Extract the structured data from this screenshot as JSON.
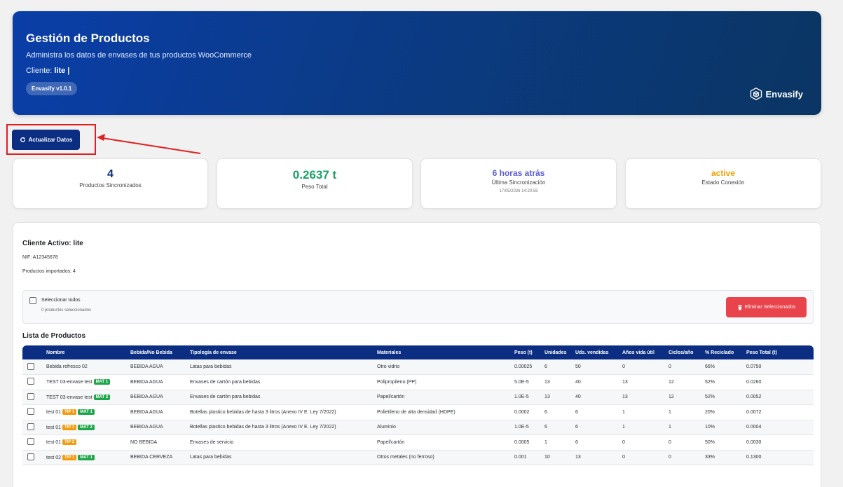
{
  "header": {
    "title": "Gestión de Productos",
    "subtitle": "Administra los datos de envases de tus productos WooCommerce",
    "client_label": "Cliente:",
    "client_value": "lite |",
    "version": "Envasify v1.0.1",
    "brand": "Envasify",
    "brand_icon": "cube-icon"
  },
  "actions": {
    "refresh_label": "Actualizar Datos",
    "refresh_icon": "refresh-icon"
  },
  "stats": [
    {
      "value": "4",
      "label": "Productos Sincronizados",
      "sub": "",
      "color": "#0b2e83"
    },
    {
      "value": "0.2637 t",
      "label": "Peso Total",
      "sub": "",
      "color": "#1aa267"
    },
    {
      "value": "6 horas atrás",
      "label": "Última Sincronización",
      "sub": "17/05/2026 14:20:59",
      "color": "#5b5bd6"
    },
    {
      "value": "active",
      "label": "Estado Conexión",
      "sub": "",
      "color": "#f0a000"
    }
  ],
  "client": {
    "title": "Cliente Activo: lite",
    "nif": "NIF: A12345678",
    "imported": "Productos importados: 4"
  },
  "selection": {
    "select_all": "Seleccionar todos",
    "count": "0 productos seleccionados",
    "delete_label": "Eliminar Seleccionados",
    "delete_icon": "trash-icon"
  },
  "list_title": "Lista de Productos",
  "table": {
    "columns": [
      "Nombre",
      "Bebida/No Bebida",
      "Tipología de envase",
      "Materiales",
      "Peso (t)",
      "Unidades",
      "Uds. vendidas",
      "Años vida útil",
      "Ciclos/año",
      "% Reciclado",
      "Peso Total (t)"
    ],
    "rows": [
      {
        "name": "Bebida refresco 02",
        "badges": [],
        "bebida": "BEBIDA AGUA",
        "tipologia": "Latas para bebidas",
        "materiales": "Otro vidrio",
        "peso": "0.00025",
        "unidades": "6",
        "vendidas": "50",
        "vida": "0",
        "ciclos": "0",
        "reciclado": "66%",
        "total": "0.0750"
      },
      {
        "name": "TEST 03-envase test",
        "badges": [
          {
            "text": "MAT 1",
            "kind": "mat"
          }
        ],
        "bebida": "BEBIDA AGUA",
        "tipologia": "Envases de cartón para bebidas",
        "materiales": "Polipropileno (PP)",
        "peso": "5.0E-5",
        "unidades": "13",
        "vendidas": "40",
        "vida": "13",
        "ciclos": "12",
        "reciclado": "52%",
        "total": "0.0260"
      },
      {
        "name": "TEST 03-envase test",
        "badges": [
          {
            "text": "MAT 2",
            "kind": "mat"
          }
        ],
        "bebida": "BEBIDA AGUA",
        "tipologia": "Envases de cartón para bebidas",
        "materiales": "Papel/cartón",
        "peso": "1.0E-5",
        "unidades": "13",
        "vendidas": "40",
        "vida": "13",
        "ciclos": "12",
        "reciclado": "52%",
        "total": "0.0052"
      },
      {
        "name": "test 01",
        "badges": [
          {
            "text": "TIP 1",
            "kind": "tip"
          },
          {
            "text": "MAT 1",
            "kind": "mat"
          }
        ],
        "bebida": "BEBIDA AGUA",
        "tipologia": "Botellas plastico bebidas de hasta 3 litros (Anexo IV E. Ley 7/2022)",
        "materiales": "Polietileno de alta densidad (HDPE)",
        "peso": "0.0002",
        "unidades": "6",
        "vendidas": "6",
        "vida": "1",
        "ciclos": "1",
        "reciclado": "20%",
        "total": "0.0072"
      },
      {
        "name": "test 01",
        "badges": [
          {
            "text": "TIP 1",
            "kind": "tip"
          },
          {
            "text": "MAT 2",
            "kind": "mat"
          }
        ],
        "bebida": "BEBIDA AGUA",
        "tipologia": "Botellas plastico bebidas de hasta 3 litros (Anexo IV E. Ley 7/2022)",
        "materiales": "Aluminio",
        "peso": "1.0E-5",
        "unidades": "6",
        "vendidas": "6",
        "vida": "1",
        "ciclos": "1",
        "reciclado": "10%",
        "total": "0.0004"
      },
      {
        "name": "test 01",
        "badges": [
          {
            "text": "TIP 2",
            "kind": "tip"
          }
        ],
        "bebida": "NO BEBIDA",
        "tipologia": "Envases de servicio",
        "materiales": "Papel/cartón",
        "peso": "0.0005",
        "unidades": "1",
        "vendidas": "6",
        "vida": "0",
        "ciclos": "0",
        "reciclado": "50%",
        "total": "0.0030"
      },
      {
        "name": "test 02",
        "badges": [
          {
            "text": "TIP 1",
            "kind": "tip"
          },
          {
            "text": "MAT 1",
            "kind": "mat"
          }
        ],
        "bebida": "BEBIDA CERVEZA",
        "tipologia": "Latas para bebidas",
        "materiales": "Otros metales (no ferroso)",
        "peso": "0.001",
        "unidades": "10",
        "vendidas": "13",
        "vida": "0",
        "ciclos": "0",
        "reciclado": "33%",
        "total": "0.1300"
      }
    ]
  },
  "colors": {
    "header": "#0a3ea8",
    "primary": "#0b2e83",
    "danger": "#e9444b",
    "annotation": "#e02020"
  }
}
